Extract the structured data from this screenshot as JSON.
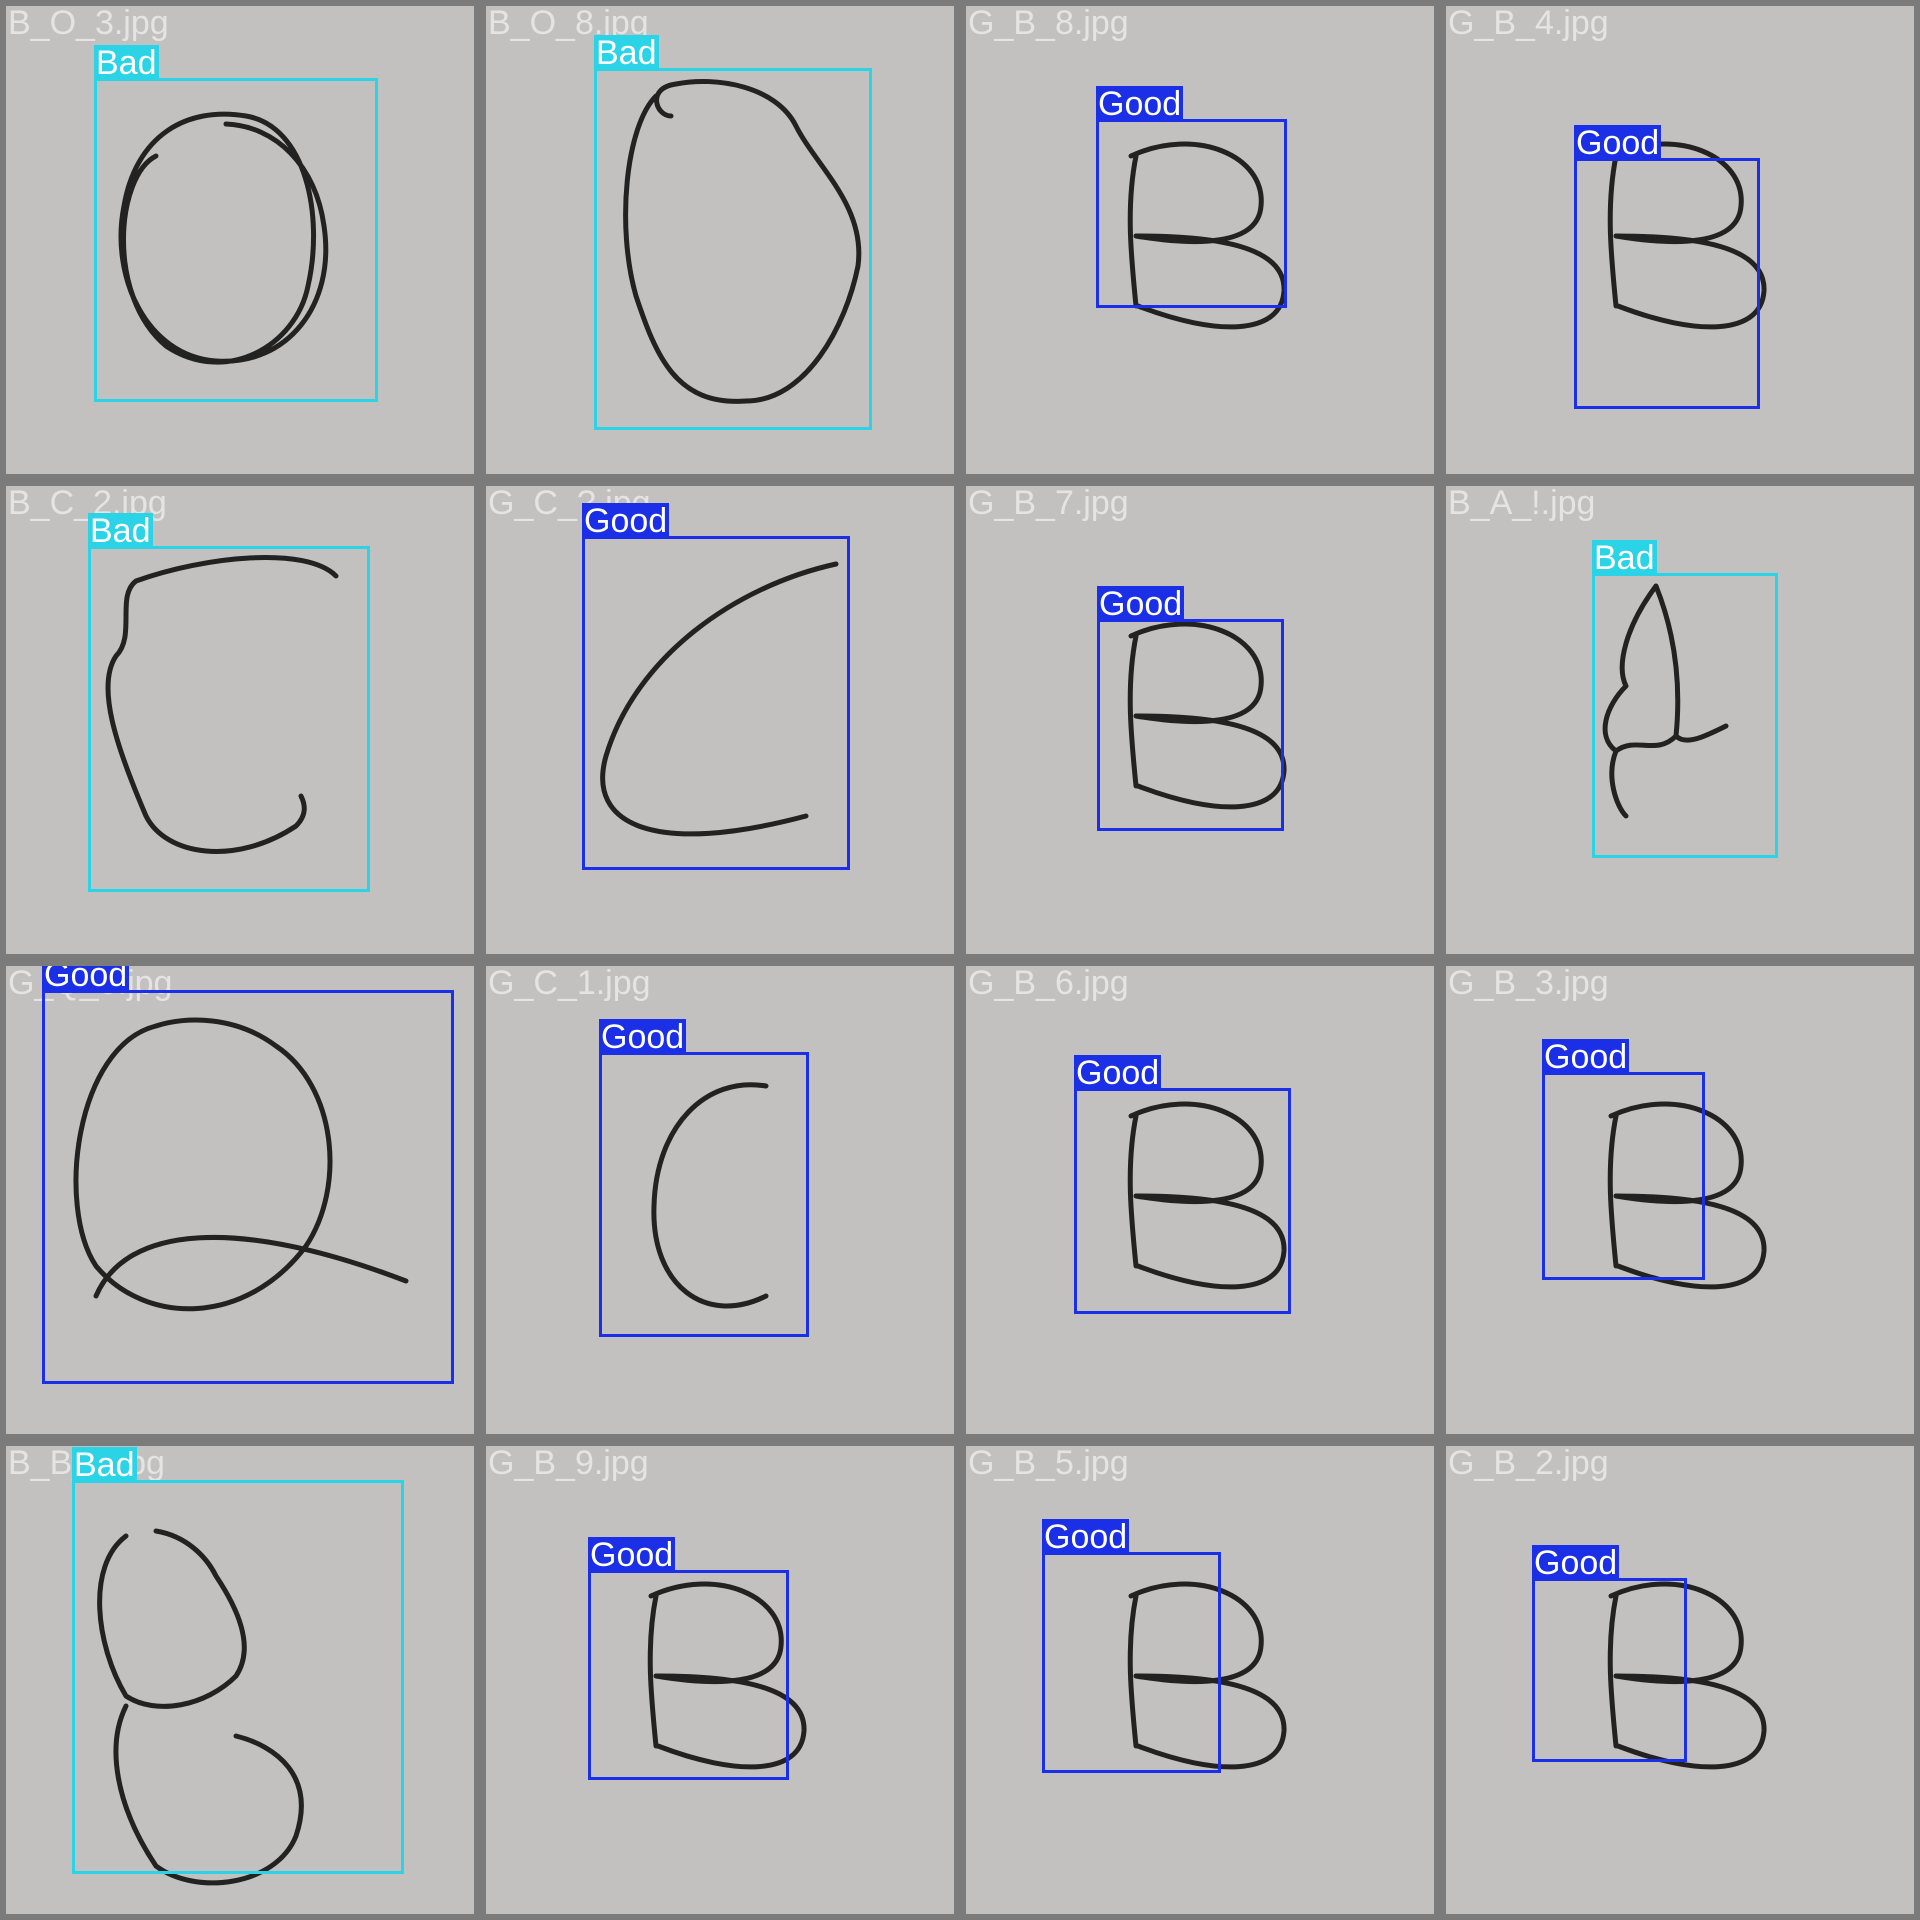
{
  "colors": {
    "bad": "#2bd3e6",
    "good": "#1a2fe6",
    "tile_bg": "#c3c1bf",
    "grid_bg": "#7b7b7b"
  },
  "grid": [
    {
      "filename": "B_O_3.jpg",
      "label": "Bad",
      "glyph": "O-scribble"
    },
    {
      "filename": "B_O_8.jpg",
      "label": "Bad",
      "glyph": "O-blob"
    },
    {
      "filename": "G_B_8.jpg",
      "label": "Good",
      "glyph": "B"
    },
    {
      "filename": "G_B_4.jpg",
      "label": "Good",
      "glyph": "B"
    },
    {
      "filename": "B_C_2.jpg",
      "label": "Bad",
      "glyph": "C-wavy"
    },
    {
      "filename": "G_C_?.jpg",
      "label": "Good",
      "glyph": "C-arc"
    },
    {
      "filename": "G_B_7.jpg",
      "label": "Good",
      "glyph": "B"
    },
    {
      "filename": "B_A_!.jpg",
      "label": "Bad",
      "glyph": "A-scribble"
    },
    {
      "filename": "G_Q_0.jpg",
      "label": "Good",
      "glyph": "Q"
    },
    {
      "filename": "G_C_1.jpg",
      "label": "Good",
      "glyph": "C"
    },
    {
      "filename": "G_B_6.jpg",
      "label": "Good",
      "glyph": "B"
    },
    {
      "filename": "G_B_3.jpg",
      "label": "Good",
      "glyph": "B"
    },
    {
      "filename": "B_B_?.jpg",
      "label": "Bad",
      "glyph": "B-scribble"
    },
    {
      "filename": "G_B_9.jpg",
      "label": "Good",
      "glyph": "B"
    },
    {
      "filename": "G_B_5.jpg",
      "label": "Good",
      "glyph": "B"
    },
    {
      "filename": "G_B_2.jpg",
      "label": "Good",
      "glyph": "B"
    }
  ]
}
